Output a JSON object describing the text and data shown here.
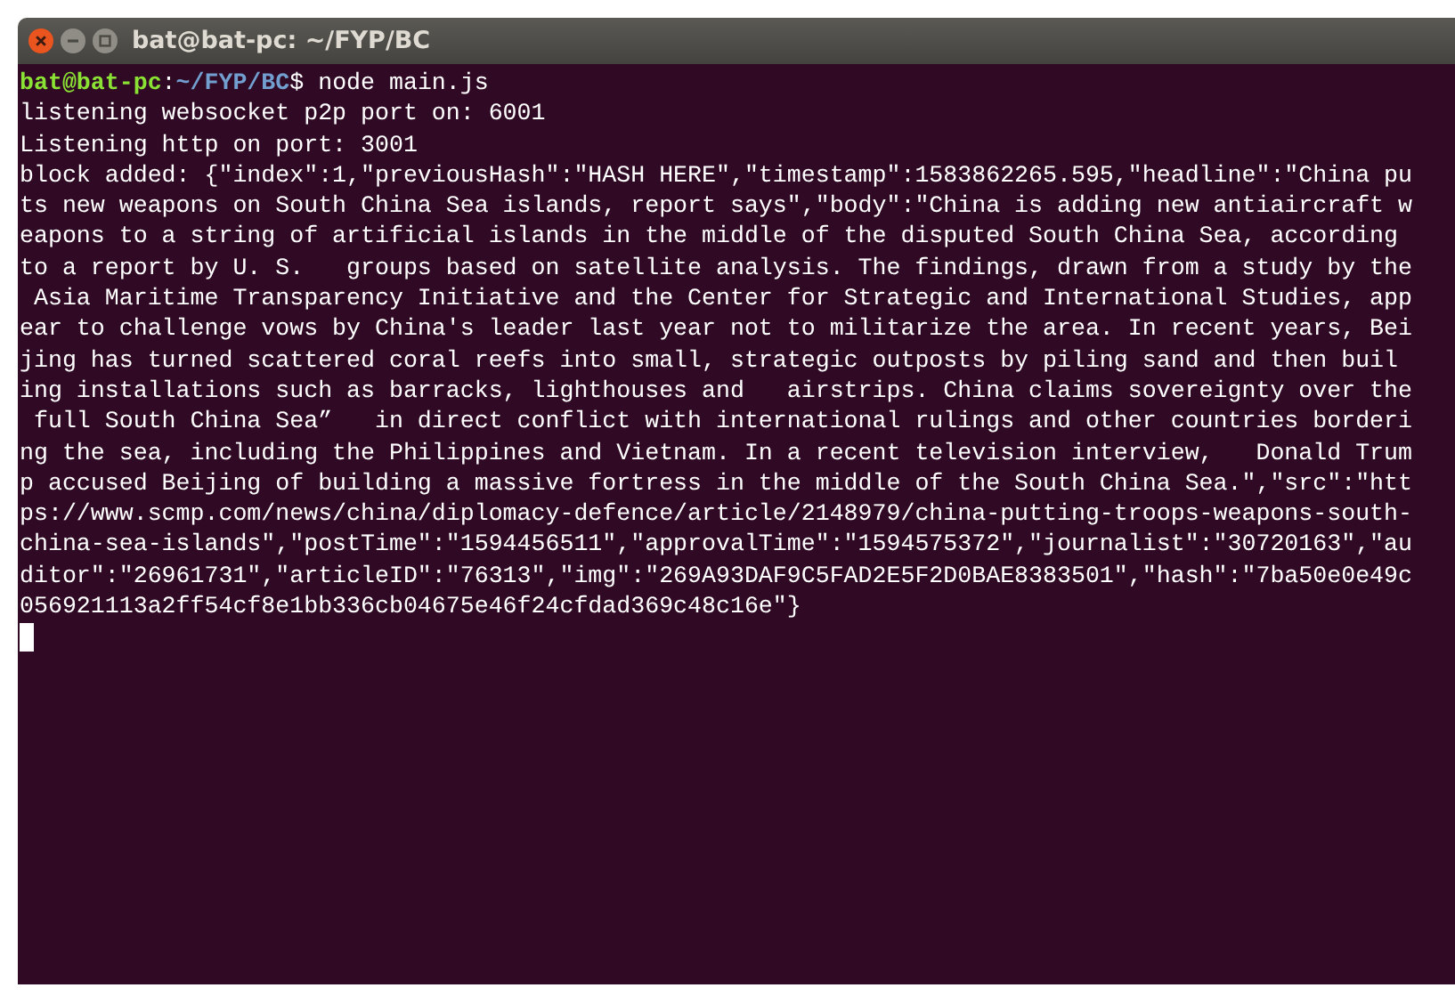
{
  "window": {
    "title": "bat@bat-pc: ~/FYP/BC"
  },
  "terminal": {
    "prompt": {
      "user_host": "bat@bat-pc",
      "separator": ":",
      "path": "~/FYP/BC",
      "symbol": "$",
      "command": "node main.js"
    },
    "output": [
      "listening websocket p2p port on: 6001",
      "Listening http on port: 3001",
      "block added: {\"index\":1,\"previousHash\":\"HASH HERE\",\"timestamp\":1583862265.595,\"headline\":\"China pu",
      "ts new weapons on South China Sea islands, report says\",\"body\":\"China is adding new antiaircraft w",
      "eapons to a string of artificial islands in the middle of the disputed South China Sea, according",
      "to a report by U. S.   groups based on satellite analysis. The findings, drawn from a study by the",
      " Asia Maritime Transparency Initiative and the Center for Strategic and International Studies, app",
      "ear to challenge vows by China's leader last year not to militarize the area. In recent years, Bei",
      "jing has turned scattered coral reefs into small, strategic outposts by piling sand and then buil",
      "ing installations such as barracks, lighthouses and   airstrips. China claims sovereignty over the",
      " full South China Sea”   in direct conflict with international rulings and other countries borderi",
      "ng the sea, including the Philippines and Vietnam. In a recent television interview,   Donald Trum",
      "p accused Beijing of building a massive fortress in the middle of the South China Sea.\",\"src\":\"htt",
      "ps://www.scmp.com/news/china/diplomacy-defence/article/2148979/china-putting-troops-weapons-south-",
      "china-sea-islands\",\"postTime\":\"1594456511\",\"approvalTime\":\"1594575372\",\"journalist\":\"30720163\",\"au",
      "ditor\":\"26961731\",\"articleID\":\"76313\",\"img\":\"269A93DAF9C5FAD2E5F2D0BAE8383501\",\"hash\":\"7ba50e0e49c",
      "056921113a2ff54cf8e1bb336cb04675e46f24cfdad369c48c16e\"}"
    ],
    "cursor_visible": true
  }
}
